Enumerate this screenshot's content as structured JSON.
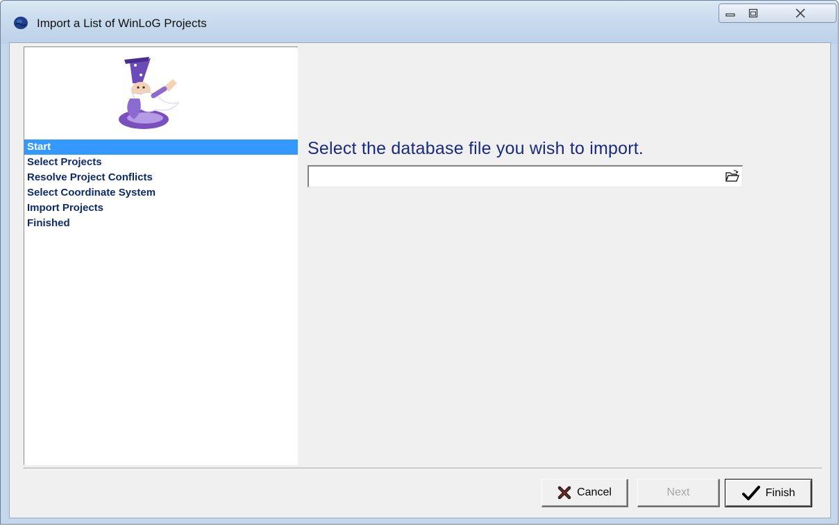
{
  "window": {
    "title": "Import a List of WinLoG Projects"
  },
  "sidebar": {
    "steps": [
      {
        "label": "Start",
        "active": true
      },
      {
        "label": "Select Projects",
        "active": false
      },
      {
        "label": "Resolve Project Conflicts",
        "active": false
      },
      {
        "label": "Select Coordinate System",
        "active": false
      },
      {
        "label": "Import Projects",
        "active": false
      },
      {
        "label": "Finished",
        "active": false
      }
    ]
  },
  "main": {
    "prompt": "Select the database file you wish to import.",
    "file_path": {
      "value": "",
      "placeholder": ""
    }
  },
  "buttons": {
    "cancel_label": "Cancel",
    "next_label": "Next",
    "finish_label": "Finish",
    "next_enabled": false
  },
  "colors": {
    "selection": "#3399ff",
    "step_text": "#0d2a6b",
    "prompt_text": "#1a2a80",
    "cancel_icon": "#1b1b1b"
  },
  "icons": {
    "app": "globe-icon",
    "wizard": "wizard-mascot-icon",
    "browse": "open-folder-icon",
    "cancel": "x-mark-icon",
    "finish": "checkmark-icon"
  }
}
